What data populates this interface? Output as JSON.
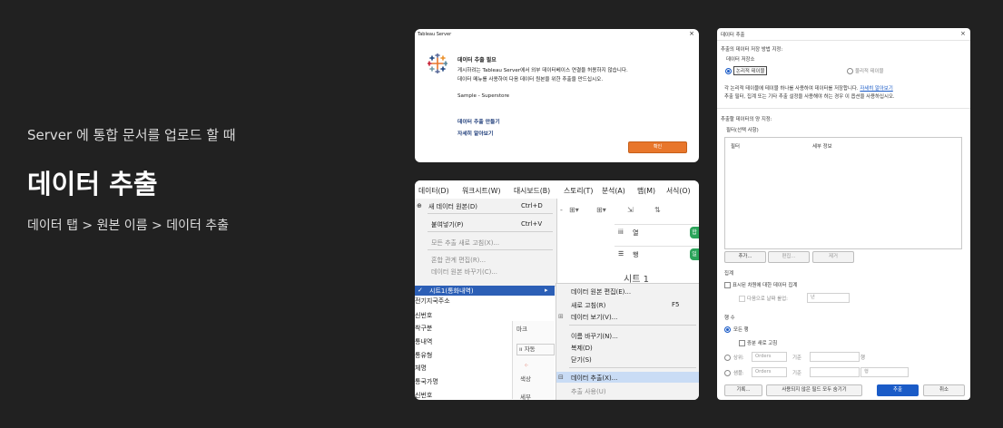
{
  "intro": {
    "subtitle": "Server 에 통합 문서를 업로드 할 때",
    "title": "데이터 추출",
    "path": "데이터 탭 > 원본 이름 > 데이터 추출"
  },
  "server_dialog": {
    "window_title": "Tableau Server",
    "close": "×",
    "heading": "데이터 추출 필요",
    "message_1": "게시하려는 Tableau Server에서 외부 데이터베이스 연결을 허용하지 않습니다.",
    "message_2": "데이터 메뉴를 사용하여 다음 데이터 원본을 위한 추출을 만드십시오.",
    "source": "Sample - Superstore",
    "link_create": "데이터 추출 만들기",
    "link_more": "자세히 알아보기",
    "ok_label": "확인",
    "accent": "#e8762b"
  },
  "menu_window": {
    "menubar": [
      "데이터(D)",
      "워크시트(W)",
      "대시보드(B)",
      "스토리(T)",
      "분석(A)",
      "맵(M)",
      "서식(O)"
    ],
    "data_menu": {
      "new_source": "새 데이터 원본(D)",
      "new_source_shortcut": "Ctrl+D",
      "paste": "붙여넣기(P)",
      "paste_shortcut": "Ctrl+V",
      "refresh_all": "모든 추출 새로 고침(X)...",
      "edit_relations": "혼합 관계 편집(R)...",
      "replace_source": "데이터 원본 바꾸기(C)..."
    },
    "selected_source": "시트1(통화내역)",
    "submenu": {
      "edit_source": "데이터 원본 편집(E)...",
      "refresh": "새로 고침(R)",
      "refresh_shortcut": "F5",
      "view_data": "데이터 보기(V)...",
      "rename": "이름 바꾸기(N)...",
      "duplicate": "복제(D)",
      "close": "닫기(S)",
      "extract": "데이터 추출(X)...",
      "use_extract": "추출 사용(U)"
    },
    "fields": [
      "전기지국주소",
      "신번호",
      "착구분",
      "통내역",
      "통유형",
      "체명",
      "통국가명",
      "신번호"
    ],
    "shelves": {
      "columns": "열",
      "rows": "행",
      "sheet": "시트 1"
    },
    "pills": {
      "columns": "합",
      "rows": "일"
    },
    "marks": {
      "title": "마크",
      "auto": "자동",
      "color": "색상",
      "detail": "세부"
    }
  },
  "extract_dialog": {
    "title": "데이터 추출",
    "close": "×",
    "storage_label": "추출의 데이터 저장 방법 지정:",
    "storage_group": "데이터 저장소",
    "logical": "논리적 테이블",
    "physical": "물리적 테이블",
    "desc_1": "각 논리적 테이블에 테이블 하나를 사용하여 데이터를 저장합니다.",
    "desc_link": "자세히 알아보기",
    "desc_2": "추출 필터, 집계 또는 기타 추출 설정을 사용해야 하는 경우 이 옵션을 사용하십시오.",
    "amount_label": "추출할 데이터의 양 지정:",
    "filters_label": "필터(선택 사항)",
    "col_filter": "필터",
    "col_detail": "세부 정보",
    "add": "추가...",
    "edit": "편집...",
    "remove": "제거",
    "agg_label": "집계",
    "agg_visible": "표시된 차원에 대한 데이터 집계",
    "rollup": "다음으로 날짜 롤업:",
    "rollup_value": "년",
    "rows_label": "행 수",
    "all_rows": "모든 행",
    "incremental": "증분 새로 고침",
    "top": "상위:",
    "sample": "샘플:",
    "table_value": "Orders",
    "by": "기준",
    "rows_unit": "행",
    "history": "기록...",
    "hide_unused": "사용되지 않은 필드 모두 숨기기",
    "extract_btn": "추출",
    "cancel_btn": "취소",
    "accent": "#1a5bc7"
  }
}
